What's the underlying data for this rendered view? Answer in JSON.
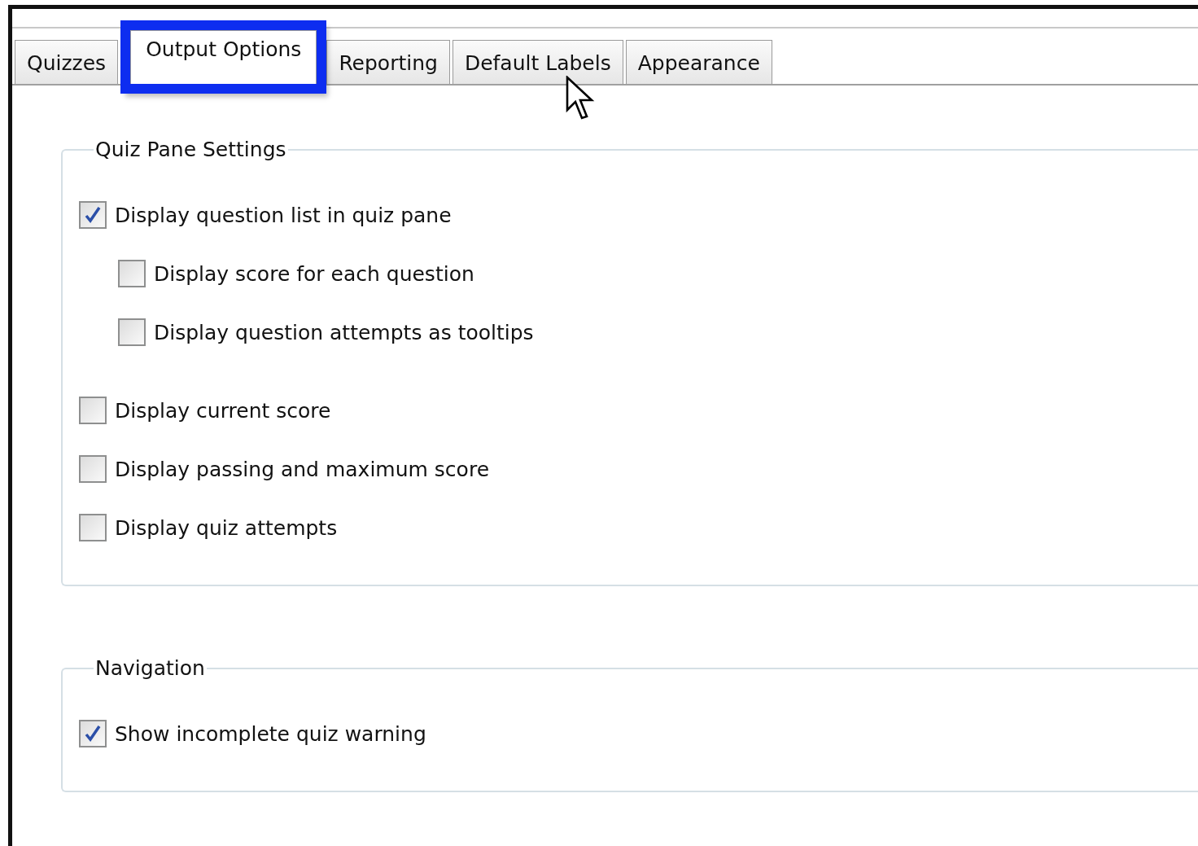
{
  "tabs": [
    {
      "label": "Quizzes",
      "selected": false
    },
    {
      "label": "Output Options",
      "selected": true
    },
    {
      "label": "Reporting",
      "selected": false
    },
    {
      "label": "Default Labels",
      "selected": false
    },
    {
      "label": "Appearance",
      "selected": false
    }
  ],
  "groups": [
    {
      "title": "Quiz Pane Settings",
      "options": [
        {
          "label": "Display question list in quiz pane",
          "checked": true,
          "children": [
            {
              "label": "Display score for each question",
              "checked": false
            },
            {
              "label": "Display question attempts as tooltips",
              "checked": false
            }
          ]
        },
        {
          "label": "Display current score",
          "checked": false
        },
        {
          "label": "Display passing and maximum score",
          "checked": false
        },
        {
          "label": "Display quiz attempts",
          "checked": false
        }
      ]
    },
    {
      "title": "Navigation",
      "options": [
        {
          "label": "Show incomplete quiz warning",
          "checked": true
        }
      ]
    }
  ]
}
